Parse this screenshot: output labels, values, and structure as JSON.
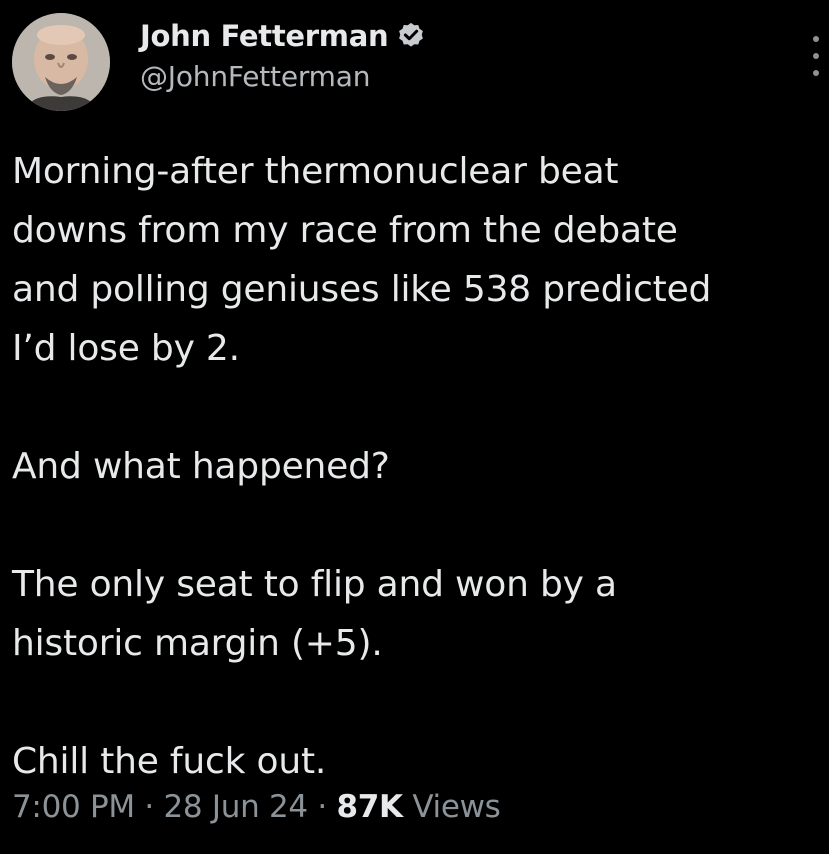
{
  "author": {
    "display_name": "John Fetterman",
    "handle": "@JohnFetterman",
    "verified": true
  },
  "tweet": {
    "lines": [
      "Morning-after thermonuclear beat",
      "downs from my race from the debate",
      "and polling geniuses like 538 predicted",
      "I’d lose by 2."
    ],
    "line2": "And what happened?",
    "lines3": [
      "The only seat to flip and won by a",
      "historic margin (+5)."
    ],
    "line4": "Chill the fuck out."
  },
  "meta": {
    "time": "7:00 PM",
    "sep1": " · ",
    "date": "28 Jun 24",
    "sep2": " · ",
    "views_count": "87K",
    "views_label": " Views"
  },
  "colors": {
    "background": "#000000",
    "text": "#e7e9ea",
    "secondary": "#8b9298",
    "verified_badge": "#c8ccd0"
  },
  "icons": {
    "verified": "verified-badge-icon",
    "more": "more-vertical-icon"
  }
}
